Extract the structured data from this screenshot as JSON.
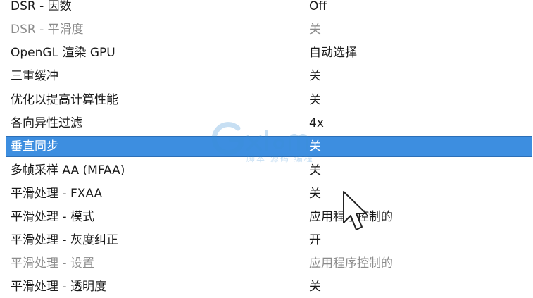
{
  "settings": [
    {
      "label": "DSR - 因数",
      "value": "Off",
      "state": "normal"
    },
    {
      "label": "DSR - 平滑度",
      "value": "关",
      "state": "disabled"
    },
    {
      "label": "OpenGL 渲染 GPU",
      "value": "自动选择",
      "state": "normal"
    },
    {
      "label": "三重缓冲",
      "value": "关",
      "state": "normal"
    },
    {
      "label": "优化以提高计算性能",
      "value": "关",
      "state": "normal"
    },
    {
      "label": "各向异性过滤",
      "value": "4x",
      "state": "normal"
    },
    {
      "label": "垂直同步",
      "value": "关",
      "state": "selected"
    },
    {
      "label": "多帧采样 AA (MFAA)",
      "value": "关",
      "state": "normal"
    },
    {
      "label": "平滑处理 - FXAA",
      "value": "关",
      "state": "normal"
    },
    {
      "label": "平滑处理 - 模式",
      "value": "应用程序控制的",
      "state": "normal"
    },
    {
      "label": "平滑处理 - 灰度纠正",
      "value": "开",
      "state": "normal"
    },
    {
      "label": "平滑处理 - 设置",
      "value": "应用程序控制的",
      "state": "disabled"
    },
    {
      "label": "平滑处理 - 透明度",
      "value": "关",
      "state": "normal"
    }
  ],
  "watermark": {
    "text": "脚本 源码 编程",
    "color": "#3b8fd6"
  },
  "colors": {
    "selected_background": "#3d8ee0",
    "selected_text": "#ffffff",
    "disabled_text": "#8c8c8c",
    "text": "#1a1a1a"
  }
}
